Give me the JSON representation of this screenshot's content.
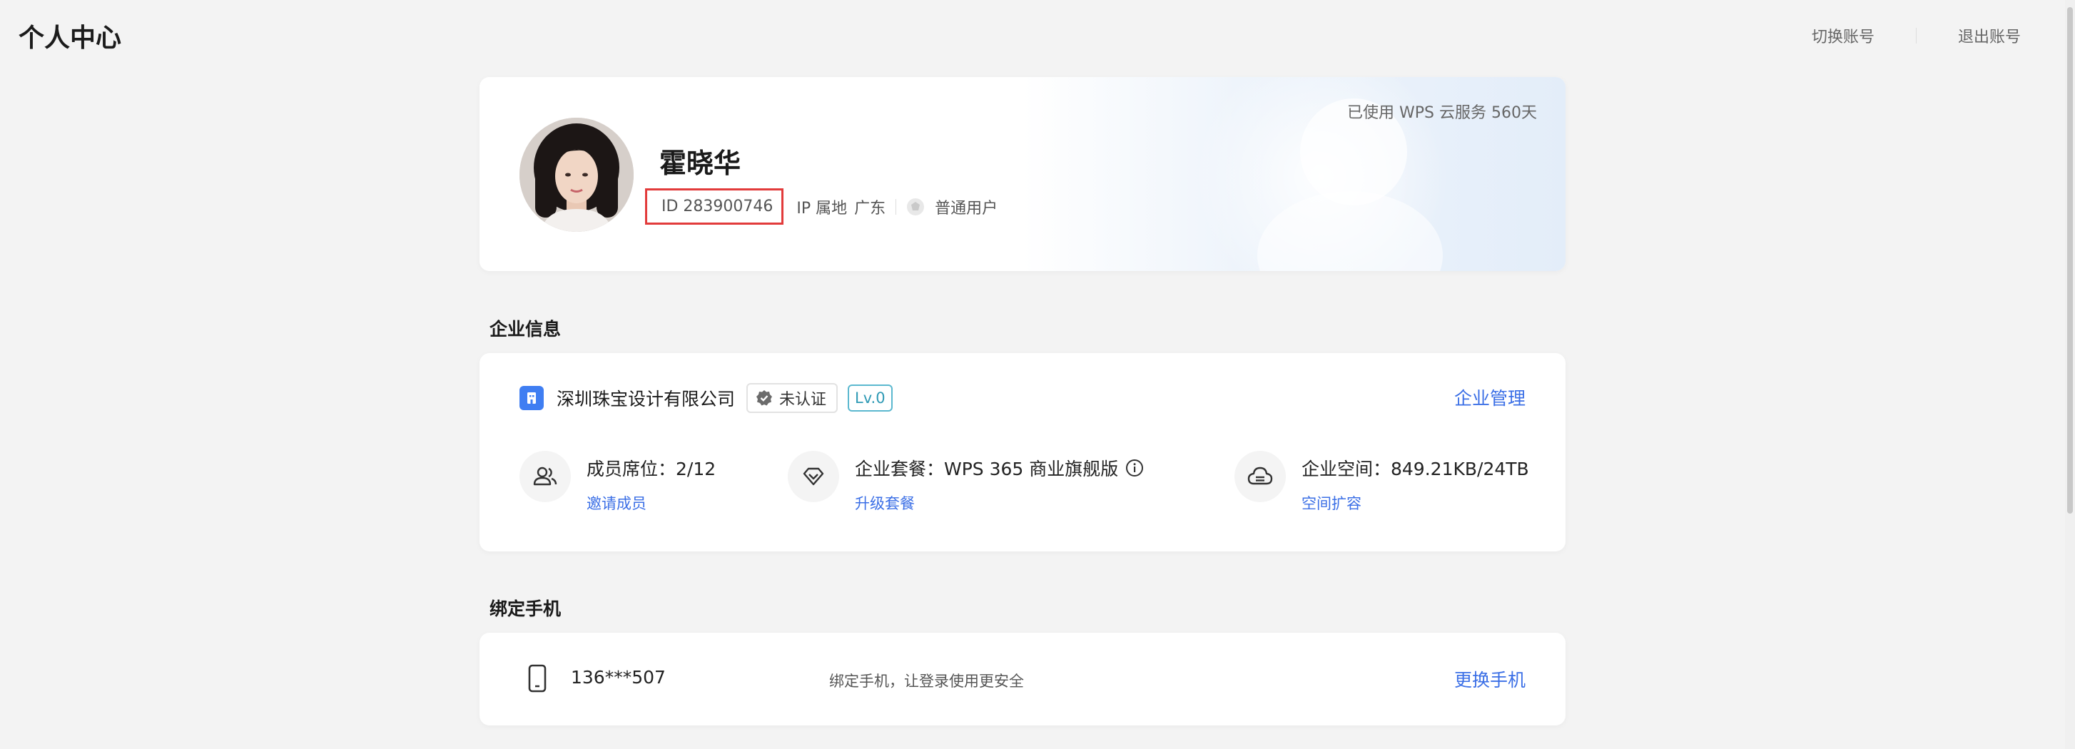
{
  "header": {
    "title": "个人中心",
    "switch_account": "切换账号",
    "logout": "退出账号"
  },
  "profile": {
    "name": "霍晓华",
    "id_text": "ID 283900746",
    "ip_label": "IP 属地",
    "ip_value": "广东",
    "user_type": "普通用户",
    "service_days": "已使用 WPS 云服务 560天"
  },
  "enterprise": {
    "section_title": "企业信息",
    "company_name": "深圳珠宝设计有限公司",
    "verify_tag": "未认证",
    "level_tag": "Lv.0",
    "manage_link": "企业管理",
    "stats": [
      {
        "label": "成员席位：2/12",
        "action": "邀请成员",
        "icon": "members-icon"
      },
      {
        "label": "企业套餐：WPS 365 商业旗舰版",
        "action": "升级套餐",
        "icon": "diamond-icon"
      },
      {
        "label": "企业空间：849.21KB/24TB",
        "action": "空间扩容",
        "icon": "cloud-storage-icon"
      }
    ]
  },
  "phone": {
    "section_title": "绑定手机",
    "number": "136***507",
    "hint": "绑定手机，让登录使用更安全",
    "change_link": "更换手机"
  },
  "colors": {
    "accent": "#3b6fe6",
    "highlight_box": "#e23b3b",
    "level_tag": "#2f9ab5",
    "company_icon": "#3f7ef2",
    "background": "#f3f3f3"
  }
}
